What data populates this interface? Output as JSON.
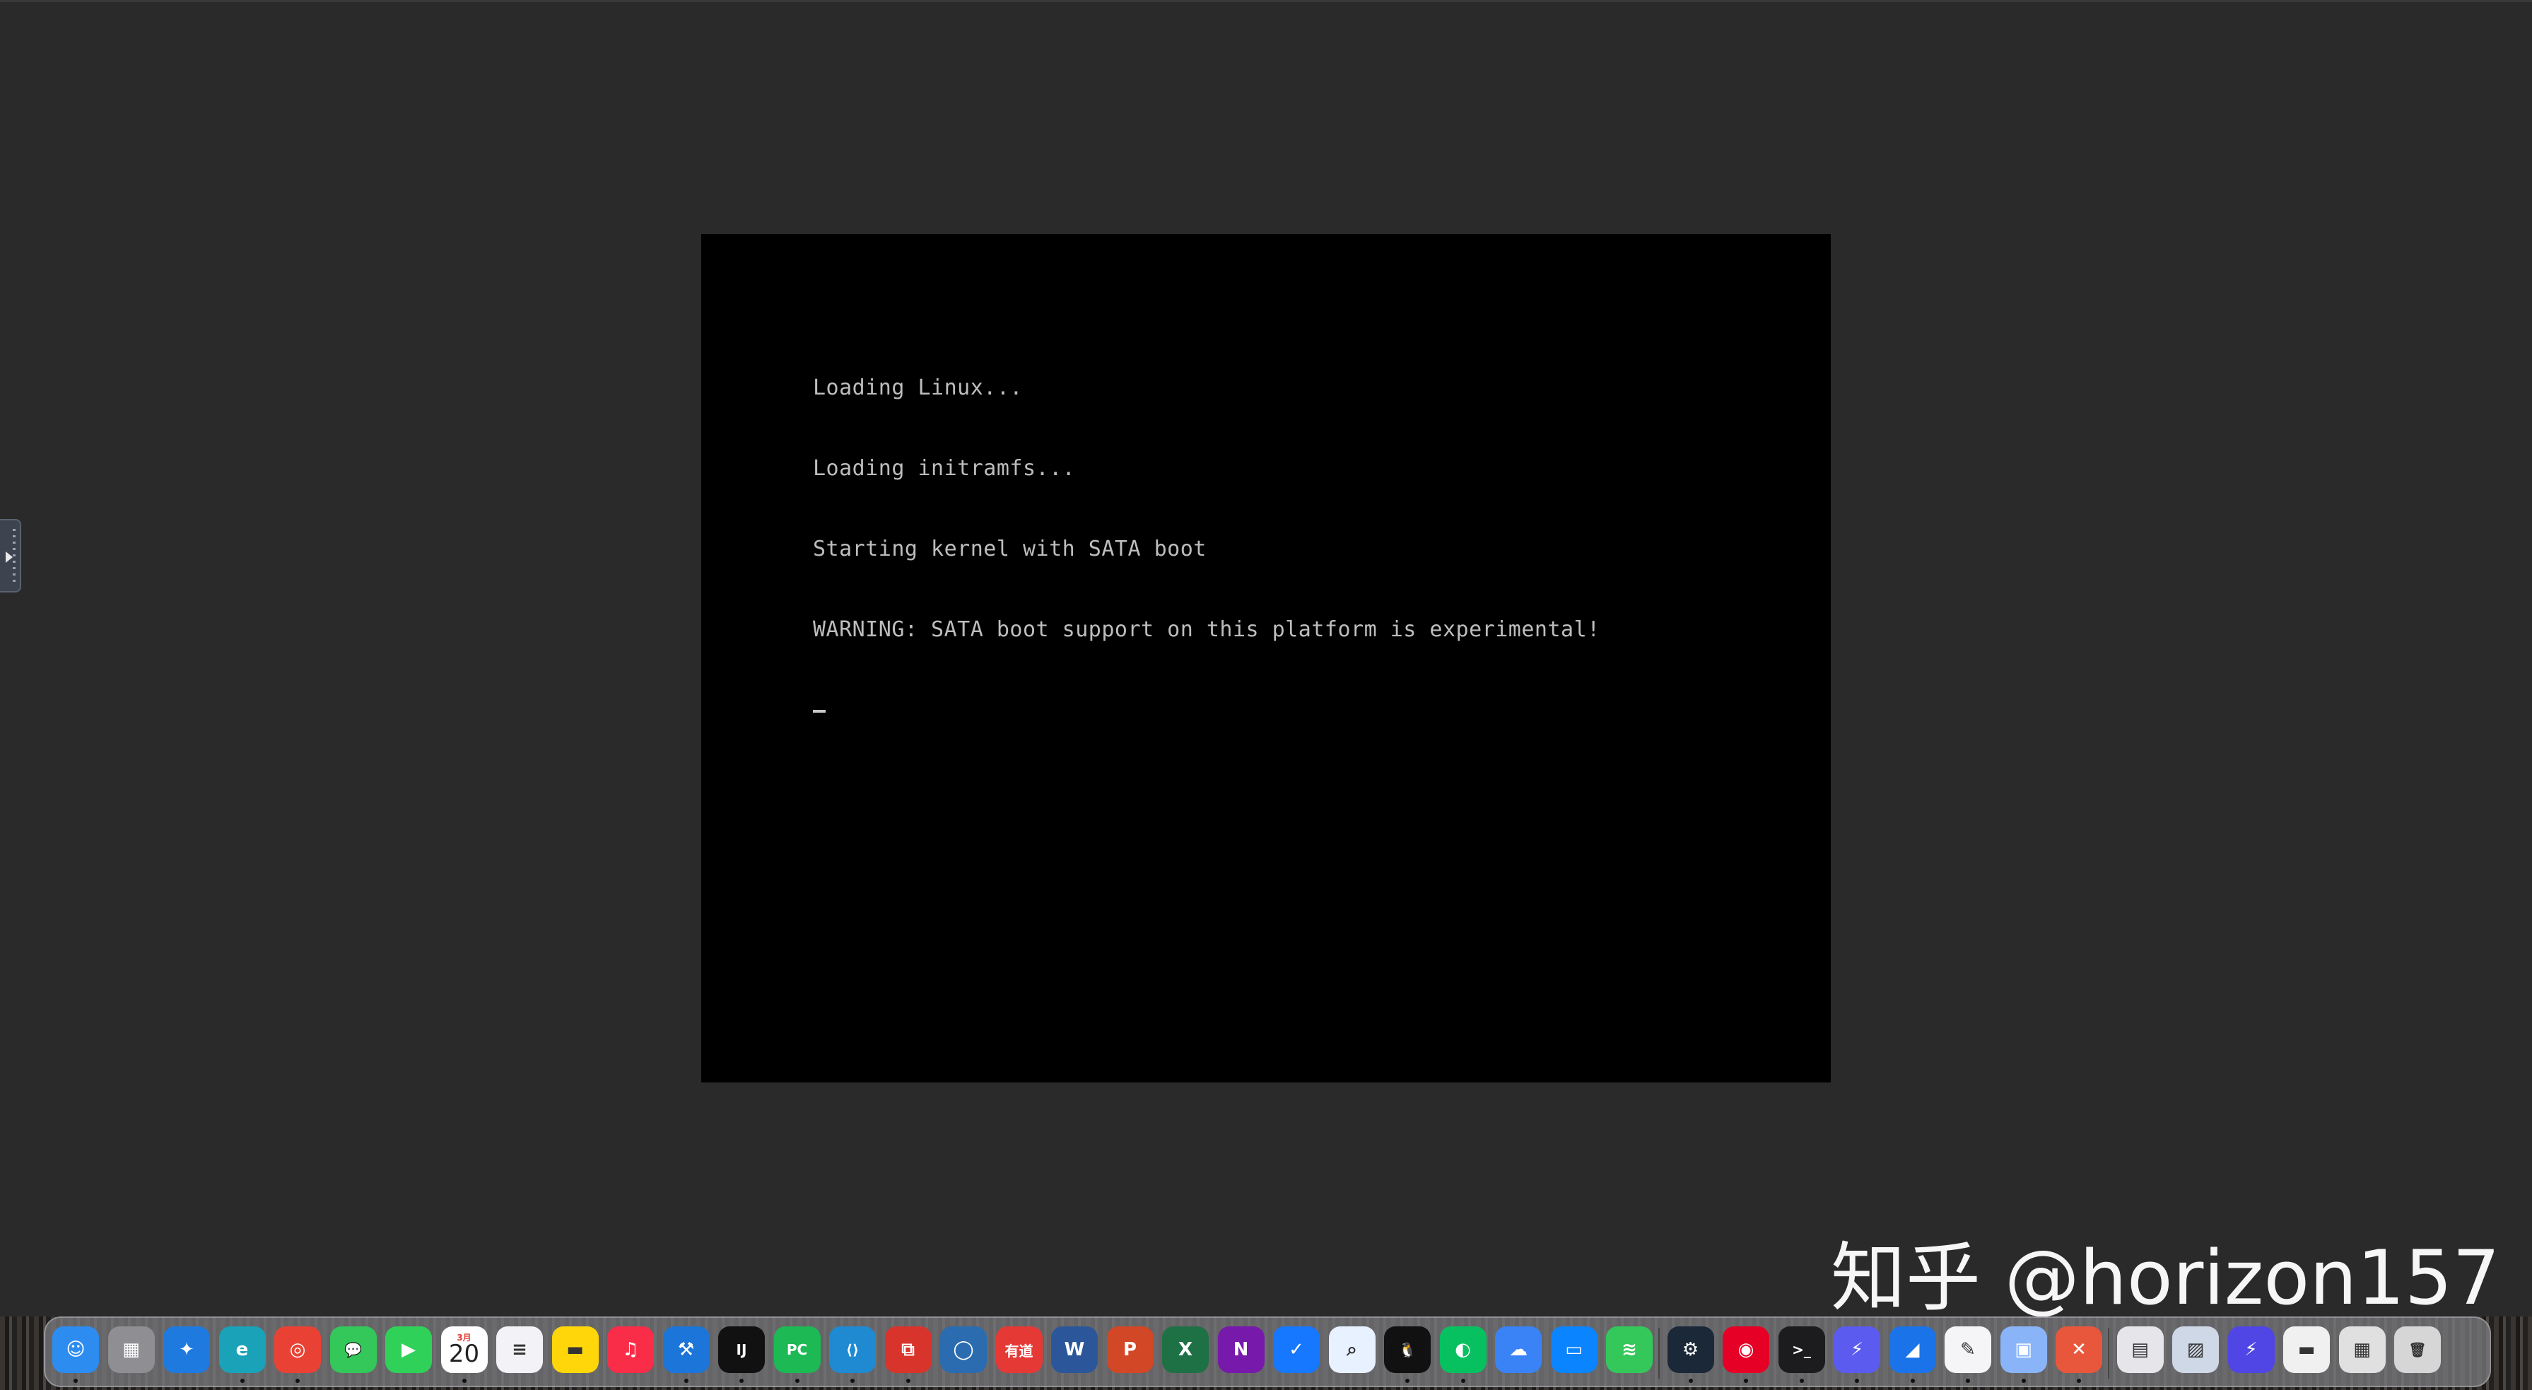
{
  "console": {
    "lines": [
      "Loading Linux...",
      "Loading initramfs...",
      "Starting kernel with SATA boot",
      "WARNING: SATA boot support on this platform is experimental!"
    ]
  },
  "watermark": {
    "text": "知乎 @horizon157"
  },
  "dock": {
    "calendar_month": "3月",
    "calendar_day": "20",
    "items": [
      {
        "name": "finder",
        "icon": "finder-icon",
        "color": "#2d8cf0",
        "glyph": "☺",
        "running": true
      },
      {
        "name": "launchpad",
        "icon": "launchpad-grid-icon",
        "color": "#8e8e93",
        "glyph": "▦",
        "running": false
      },
      {
        "name": "safari",
        "icon": "safari-compass-icon",
        "color": "#1f7ae0",
        "glyph": "✦",
        "running": false
      },
      {
        "name": "edge",
        "icon": "edge-browser-icon",
        "color": "#1aa2b8",
        "glyph": "e",
        "running": true
      },
      {
        "name": "chrome",
        "icon": "chrome-browser-icon",
        "color": "#e94235",
        "glyph": "◎",
        "running": true
      },
      {
        "name": "messages",
        "icon": "messages-bubble-icon",
        "color": "#34c759",
        "glyph": "💬",
        "running": false
      },
      {
        "name": "facetime",
        "icon": "facetime-camera-icon",
        "color": "#30d158",
        "glyph": "▶",
        "running": false
      },
      {
        "name": "calendar",
        "icon": "calendar-icon",
        "color": "#ffffff",
        "glyph": "",
        "running": true
      },
      {
        "name": "reminders",
        "icon": "reminders-list-icon",
        "color": "#f2f2f7",
        "glyph": "≡",
        "running": false
      },
      {
        "name": "notes",
        "icon": "notes-icon",
        "color": "#ffd60a",
        "glyph": "▬",
        "running": false
      },
      {
        "name": "music",
        "icon": "music-note-icon",
        "color": "#fa2d48",
        "glyph": "♫",
        "running": false
      },
      {
        "name": "xcode",
        "icon": "xcode-hammer-icon",
        "color": "#1c75d9",
        "glyph": "⚒",
        "running": true
      },
      {
        "name": "intellij",
        "icon": "intellij-idea-icon",
        "color": "#111111",
        "glyph": "IJ",
        "running": true
      },
      {
        "name": "pycharm",
        "icon": "pycharm-icon",
        "color": "#1db954",
        "glyph": "PC",
        "running": true
      },
      {
        "name": "vscode",
        "icon": "vscode-icon",
        "color": "#1f8ad2",
        "glyph": "⟨⟩",
        "running": true
      },
      {
        "name": "parallels",
        "icon": "parallels-desktop-icon",
        "color": "#d9342b",
        "glyph": "⧉",
        "running": true
      },
      {
        "name": "blender-like",
        "icon": "circle-ring-icon",
        "color": "#2b6cb0",
        "glyph": "◯",
        "running": false
      },
      {
        "name": "youdao",
        "icon": "youdao-dict-icon",
        "color": "#e53935",
        "glyph": "有道",
        "running": false
      },
      {
        "name": "word",
        "icon": "word-doc-icon",
        "color": "#2b579a",
        "glyph": "W",
        "running": false
      },
      {
        "name": "powerpoint",
        "icon": "powerpoint-icon",
        "color": "#d24726",
        "glyph": "P",
        "running": false
      },
      {
        "name": "excel",
        "icon": "excel-icon",
        "color": "#1e7145",
        "glyph": "X",
        "running": false
      },
      {
        "name": "onenote",
        "icon": "onenote-icon",
        "color": "#7719aa",
        "glyph": "N",
        "running": false
      },
      {
        "name": "dingtalk-like",
        "icon": "check-bird-icon",
        "color": "#1677ff",
        "glyph": "✓",
        "running": false
      },
      {
        "name": "search-app",
        "icon": "magnifier-bubble-icon",
        "color": "#e8f1ff",
        "glyph": "⌕",
        "running": false
      },
      {
        "name": "qq",
        "icon": "qq-penguin-icon",
        "color": "#111111",
        "glyph": "🐧",
        "running": true
      },
      {
        "name": "wechat",
        "icon": "wechat-icon",
        "color": "#07c160",
        "glyph": "◐",
        "running": true
      },
      {
        "name": "baidu-netdisk",
        "icon": "cloud-drive-icon",
        "color": "#3a83f6",
        "glyph": "☁",
        "running": false
      },
      {
        "name": "remote-screen",
        "icon": "monitor-icon",
        "color": "#0a84ff",
        "glyph": "▭",
        "running": false
      },
      {
        "name": "layers-app",
        "icon": "layers-stack-icon",
        "color": "#34c759",
        "glyph": "≋",
        "running": false
      },
      {
        "name": "steam",
        "icon": "steam-icon",
        "color": "#1b2838",
        "glyph": "⚙",
        "running": true
      },
      {
        "name": "netease-music",
        "icon": "netease-music-icon",
        "color": "#e60026",
        "glyph": "◉",
        "running": true
      },
      {
        "name": "terminal",
        "icon": "terminal-icon",
        "color": "#1c1c1e",
        "glyph": ">_",
        "running": true
      },
      {
        "name": "shortcut-app",
        "icon": "lightning-bolt-icon",
        "color": "#5b5bf0",
        "glyph": "⚡",
        "running": true
      },
      {
        "name": "wireshark",
        "icon": "shark-fin-icon",
        "color": "#1a73e8",
        "glyph": "◢",
        "running": true
      },
      {
        "name": "textedit",
        "icon": "pen-paper-icon",
        "color": "#f5f5f7",
        "glyph": "✎",
        "running": true
      },
      {
        "name": "preview",
        "icon": "preview-photos-icon",
        "color": "#8ab4f8",
        "glyph": "▣",
        "running": true
      },
      {
        "name": "remote-desktop",
        "icon": "remote-desktop-icon",
        "color": "#e8573c",
        "glyph": "✕",
        "running": true
      },
      {
        "name": "doc-stack",
        "icon": "document-stack-icon",
        "color": "#e5e5ea",
        "glyph": "▤",
        "running": false
      },
      {
        "name": "screenshot-stack",
        "icon": "screenshots-stack-icon",
        "color": "#cfd8e6",
        "glyph": "▨",
        "running": false
      },
      {
        "name": "shortcut-app-2",
        "icon": "lightning-bolt-icon",
        "color": "#4f46e5",
        "glyph": "⚡",
        "running": false
      },
      {
        "name": "downloads-stack",
        "icon": "downloads-stack-icon",
        "color": "#f0f0f0",
        "glyph": "▬",
        "running": false
      },
      {
        "name": "recents-stack",
        "icon": "recents-stack-icon",
        "color": "#e0e0e0",
        "glyph": "▦",
        "running": false
      },
      {
        "name": "trash",
        "icon": "trash-can-icon",
        "color": "#d6d6d6",
        "glyph": "🗑",
        "running": false
      }
    ]
  }
}
